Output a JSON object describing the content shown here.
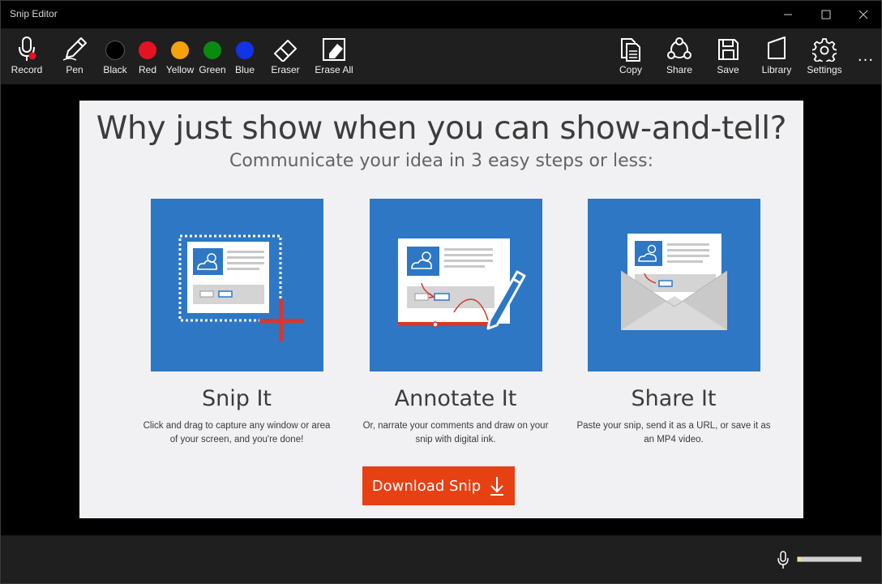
{
  "window": {
    "title": "Snip Editor"
  },
  "toolbar": {
    "record": "Record",
    "pen": "Pen",
    "colors": [
      {
        "label": "Black",
        "color": "#000000"
      },
      {
        "label": "Red",
        "color": "#e81123"
      },
      {
        "label": "Yellow",
        "color": "#f7a10b"
      },
      {
        "label": "Green",
        "color": "#0a8a10"
      },
      {
        "label": "Blue",
        "color": "#1233e8"
      }
    ],
    "eraser": "Eraser",
    "erase_all": "Erase All",
    "copy": "Copy",
    "share": "Share",
    "save": "Save",
    "library": "Library",
    "settings": "Settings",
    "more": "..."
  },
  "card": {
    "headline": "Why just show when you can show-and-tell?",
    "subline": "Communicate your idea in 3 easy steps or less:",
    "steps": [
      {
        "title": "Snip It",
        "desc": "Click and drag to capture any window or area of your screen, and you're done!"
      },
      {
        "title": "Annotate It",
        "desc": "Or, narrate your comments and draw on your snip with digital ink."
      },
      {
        "title": "Share It",
        "desc": "Paste your snip, send it as a URL, or save it as an MP4 video."
      }
    ],
    "download_label": "Download Snip"
  },
  "status": {
    "mic_level": 0.05
  },
  "colors": {
    "accent_orange": "#e64013",
    "tile_blue": "#2e77c4"
  }
}
